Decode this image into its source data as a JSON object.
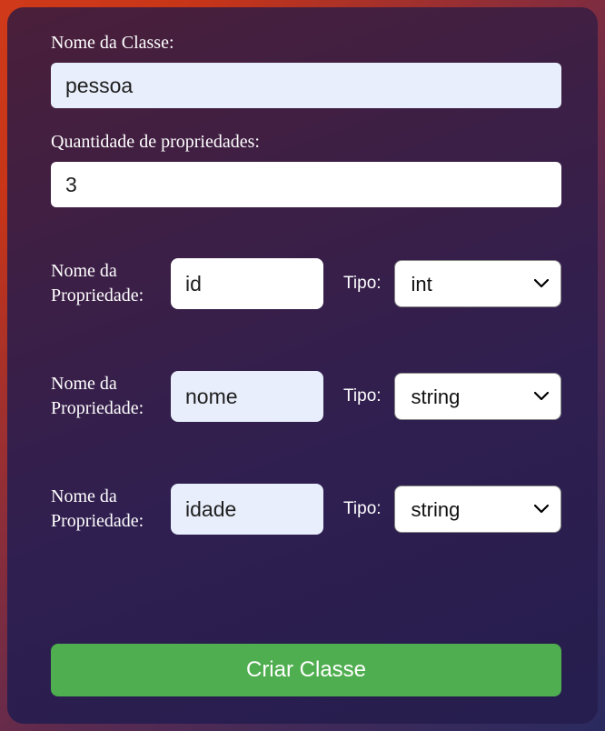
{
  "form": {
    "class_name_label": "Nome da Classe:",
    "class_name_value": "pessoa",
    "qty_label": "Quantidade de propriedades:",
    "qty_value": "3",
    "prop_name_label": "Nome da Propriedade:",
    "type_label": "Tipo:",
    "properties": [
      {
        "name": "id",
        "type": "int",
        "highlighted": false
      },
      {
        "name": "nome",
        "type": "string",
        "highlighted": true
      },
      {
        "name": "idade",
        "type": "string",
        "highlighted": true
      }
    ],
    "type_options": [
      "int",
      "string"
    ],
    "submit_label": "Criar Classe"
  }
}
